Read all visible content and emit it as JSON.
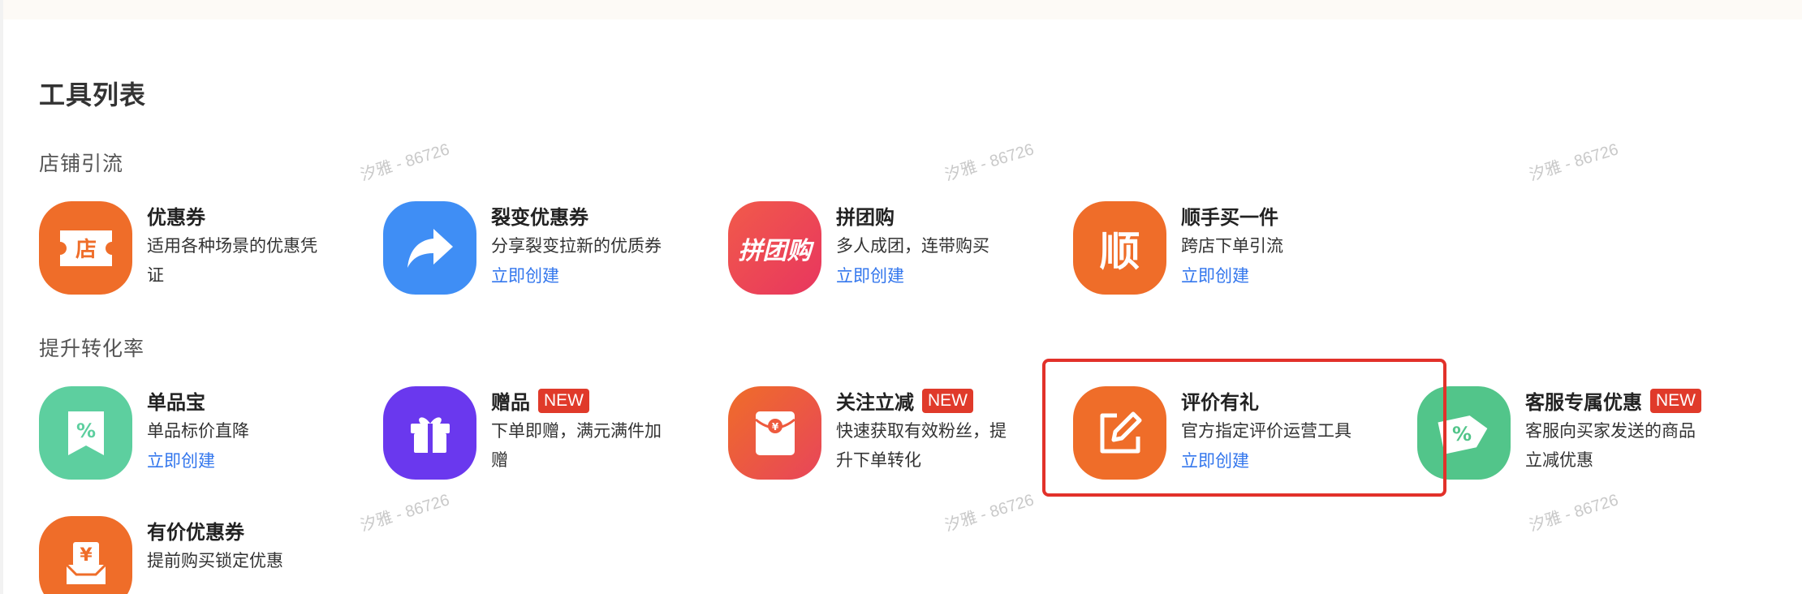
{
  "section_title": "工具列表",
  "groups": [
    {
      "title": "店铺引流"
    },
    {
      "title": "提升转化率"
    }
  ],
  "tools": [
    {
      "name": "优惠券",
      "desc": "适用各种场景的优惠凭证",
      "create": "",
      "badge": "",
      "icon": "store-coupon-icon",
      "icon_text": "店",
      "color": "#ef6d29"
    },
    {
      "name": "裂变优惠券",
      "desc": "分享裂变拉新的优质券",
      "create": "立即创建",
      "badge": "",
      "icon": "share-arrow-icon",
      "icon_text": "",
      "color": "#3f8ef5"
    },
    {
      "name": "拼团购",
      "desc": "多人成团，连带购买",
      "create": "立即创建",
      "badge": "",
      "icon": "group-buy-icon",
      "icon_text": "拼团购",
      "color": "#ea4159"
    },
    {
      "name": "顺手买一件",
      "desc": "跨店下单引流",
      "create": "立即创建",
      "badge": "",
      "icon": "shun-icon",
      "icon_text": "顺",
      "color": "#ef6d29"
    },
    {
      "name": "单品宝",
      "desc": "单品标价直降",
      "create": "立即创建",
      "badge": "",
      "icon": "percent-tag-icon",
      "icon_text": "%",
      "color": "#5dcf9f"
    },
    {
      "name": "赠品",
      "desc": "下单即赠，满元满件加赠",
      "create": "",
      "badge": "NEW",
      "icon": "gift-icon",
      "icon_text": "",
      "color": "#6a38ee"
    },
    {
      "name": "关注立减",
      "desc": "快速获取有效粉丝，提升下单转化",
      "create": "",
      "badge": "NEW",
      "icon": "red-envelope-icon",
      "icon_text": "¥",
      "color": "#ef6d29"
    },
    {
      "name": "评价有礼",
      "desc": "官方指定评价运营工具",
      "create": "立即创建",
      "badge": "",
      "icon": "edit-review-icon",
      "icon_text": "",
      "color": "#ef6d29"
    },
    {
      "name": "客服专属优惠",
      "desc": "客服向买家发送的商品立减优惠",
      "create": "",
      "badge": "NEW",
      "icon": "discount-tag-icon",
      "icon_text": "%",
      "color": "#52c58a"
    },
    {
      "name": "有价优惠券",
      "desc": "提前购买锁定优惠",
      "create": "",
      "badge": "",
      "icon": "yen-box-icon",
      "icon_text": "¥",
      "color": "#ef6d29"
    }
  ],
  "watermark": "汐雅 - 86726"
}
